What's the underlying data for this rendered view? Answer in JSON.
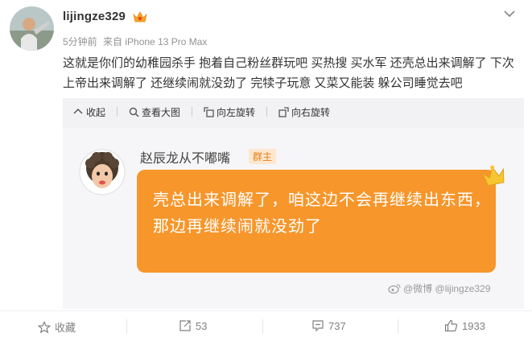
{
  "post": {
    "username": "lijingze329",
    "time": "5分钟前",
    "source": "来自 iPhone 13 Pro Max",
    "text": "这就是你们的幼稚园杀手 抱着自己粉丝群玩吧 买热搜 买水军 还壳总出来调解了 下次上帝出来调解了 还继续闹就没劲了 完犊子玩意 又菜又能装 躲公司睡觉去吧"
  },
  "media_toolbar": {
    "collapse": "收起",
    "view_large": "查看大图",
    "rotate_left": "向左旋转",
    "rotate_right": "向右旋转"
  },
  "screenshot": {
    "chat_name": "赵辰龙从不嘟嘴",
    "group_badge": "群主",
    "message": "壳总出来调解了，咱这边不会再继续出东西，那边再继续闹就没劲了",
    "watermark": "@微博 @lijingze329"
  },
  "footer": {
    "favorite": "收藏",
    "repost_count": "53",
    "comment_count": "737",
    "like_count": "1933"
  },
  "colors": {
    "accent_orange": "#f7962b",
    "meta_gray": "#939393"
  }
}
